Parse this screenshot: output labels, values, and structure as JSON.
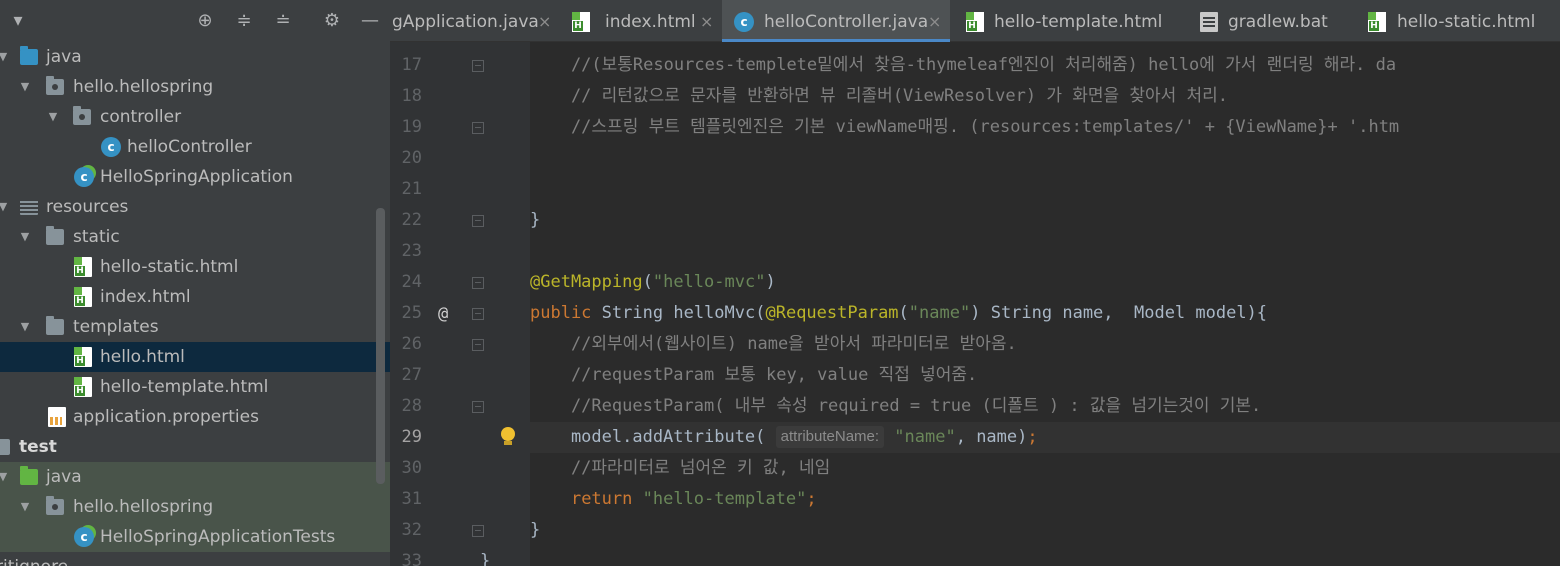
{
  "project_panel": {
    "toolbar": {
      "dropdown_icon": "chevron-down-icon",
      "locate_icon": "crosshair-icon",
      "expand_icon": "expand-all-icon",
      "collapse_icon": "collapse-all-icon",
      "settings_icon": "gear-icon",
      "hide_icon": "minimize-icon"
    },
    "tree": [
      {
        "label": "java",
        "icon": "folder-blue-icon",
        "expanded": true
      },
      {
        "label": "hello.hellospring",
        "icon": "package-icon",
        "expanded": true
      },
      {
        "label": "controller",
        "icon": "package-icon",
        "expanded": true
      },
      {
        "label": "helloController",
        "icon": "class-icon"
      },
      {
        "label": "HelloSpringApplication",
        "icon": "spring-class-icon"
      },
      {
        "label": "resources",
        "icon": "resources-folder-icon",
        "expanded": true
      },
      {
        "label": "static",
        "icon": "folder-icon",
        "expanded": true
      },
      {
        "label": "hello-static.html",
        "icon": "html-file-icon"
      },
      {
        "label": "index.html",
        "icon": "html-file-icon"
      },
      {
        "label": "templates",
        "icon": "folder-icon",
        "expanded": true
      },
      {
        "label": "hello.html",
        "icon": "html-file-icon",
        "selected": true
      },
      {
        "label": "hello-template.html",
        "icon": "html-file-icon"
      },
      {
        "label": "application.properties",
        "icon": "properties-file-icon"
      },
      {
        "label": "test",
        "icon": "folder-icon",
        "expanded": true
      },
      {
        "label": "java",
        "icon": "folder-green-icon",
        "expanded": true
      },
      {
        "label": "hello.hellospring",
        "icon": "package-icon",
        "expanded": true
      },
      {
        "label": "HelloSpringApplicationTests",
        "icon": "spring-class-icon"
      },
      {
        "label": "ritignore",
        "icon": "file-icon"
      }
    ]
  },
  "editor": {
    "tabs": [
      {
        "label": "gApplication.java",
        "icon": "none",
        "active": false
      },
      {
        "label": "index.html",
        "icon": "html-file-icon",
        "active": false
      },
      {
        "label": "helloController.java",
        "icon": "class-icon",
        "active": true
      },
      {
        "label": "hello-template.html",
        "icon": "html-file-icon",
        "active": false
      },
      {
        "label": "gradlew.bat",
        "icon": "bat-file-icon",
        "active": false
      },
      {
        "label": "hello-static.html",
        "icon": "html-file-icon",
        "active": false
      }
    ],
    "close_glyph": "×",
    "current_line": 29,
    "lines": [
      {
        "n": "17",
        "text": "    //(보통Resources-templete밑에서 찾음-thymeleaf엔진이 처리해줌) hello에 가서 랜더링 해라. da"
      },
      {
        "n": "18",
        "text": "    // 리턴값으로 문자를 반환하면 뷰 리졸버(ViewResolver) 가 화면을 찾아서 처리."
      },
      {
        "n": "19",
        "text": "    //스프링 부트 템플릿엔진은 기본 viewName매핑. (resources:templates/' + {ViewName}+ '.htm"
      },
      {
        "n": "20",
        "text": ""
      },
      {
        "n": "21",
        "text": ""
      },
      {
        "n": "22",
        "text": "}"
      },
      {
        "n": "23",
        "text": ""
      },
      {
        "n": "24",
        "annotation": "@GetMapping",
        "arg": "\"hello-mvc\""
      },
      {
        "n": "25",
        "kw": "public",
        "type": "String",
        "method": "helloMvc",
        "param_ann": "@RequestParam",
        "param_arg": "\"name\"",
        "rest": " String name,  Model model){"
      },
      {
        "n": "26",
        "text": "    //외부에서(웹사이트) name을 받아서 파라미터로 받아옴."
      },
      {
        "n": "27",
        "text": "    //requestParam 보통 key, value 직접 넣어줌."
      },
      {
        "n": "28",
        "text": "    //RequestParam( 내부 속성 required = true (디폴트 ) : 값을 넘기는것이 기본."
      },
      {
        "n": "29",
        "call": "    model.addAttribute(",
        "hint": "attributeName:",
        "str": "\"name\"",
        "tail": ", name)",
        "semi": ";"
      },
      {
        "n": "30",
        "text": "    //파라미터로 넘어온 키 값, 네임"
      },
      {
        "n": "31",
        "kw": "return",
        "str": "\"hello-template\"",
        "semi": ";"
      },
      {
        "n": "32",
        "text": "}"
      },
      {
        "n": "33",
        "text": "}"
      }
    ],
    "gutter_markers": {
      "override_at_line": "25",
      "override_glyph": "@",
      "bulb_line": "29"
    }
  },
  "colors": {
    "background": "#2b2b2b",
    "panel": "#3c3f41",
    "comment": "#808080",
    "annotation": "#bbb529",
    "string": "#6a8759",
    "keyword": "#cc7832",
    "selection": "#0d293e",
    "accent": "#4a88c7"
  }
}
